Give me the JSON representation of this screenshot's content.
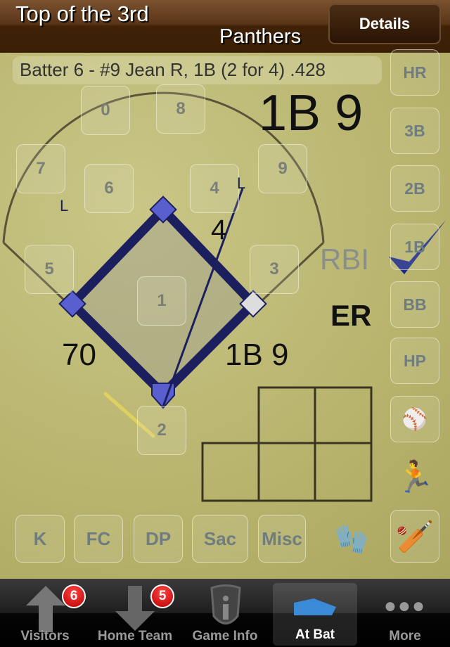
{
  "header": {
    "title": "Top of the 3rd",
    "team": "Panthers",
    "details_label": "Details"
  },
  "batter_info": "Batter 6 - #9 Jean R, 1B (2 for 4) .428",
  "result_large": "1B 9",
  "fielder_boxes": [
    "0",
    "8",
    "7",
    "6",
    "4",
    "9",
    "5",
    "3",
    "1",
    "2"
  ],
  "field_labels": {
    "hit_fielder": "4",
    "rbi": "RBI",
    "er": "ER",
    "pitch_count": "70",
    "play": "1B 9",
    "out_mark": "L"
  },
  "right_buttons": [
    "HR",
    "3B",
    "2B",
    "1B",
    "BB",
    "HP"
  ],
  "bottom_buttons": [
    "K",
    "FC",
    "DP",
    "Sac",
    "Misc"
  ],
  "tabs": [
    {
      "label": "Visitors",
      "badge": "6",
      "icon": "arrow-up-icon"
    },
    {
      "label": "Home Team",
      "badge": "5",
      "icon": "arrow-down-icon"
    },
    {
      "label": "Game Info",
      "icon": "info-shield-icon"
    },
    {
      "label": "At Bat",
      "icon": "home-plate-icon",
      "active": true
    },
    {
      "label": "More",
      "icon": "more-dots-icon"
    }
  ],
  "colors": {
    "diamond": "#1c1f5e",
    "base_occupied": "#5a5fd0",
    "check": "#1c2a8a"
  }
}
